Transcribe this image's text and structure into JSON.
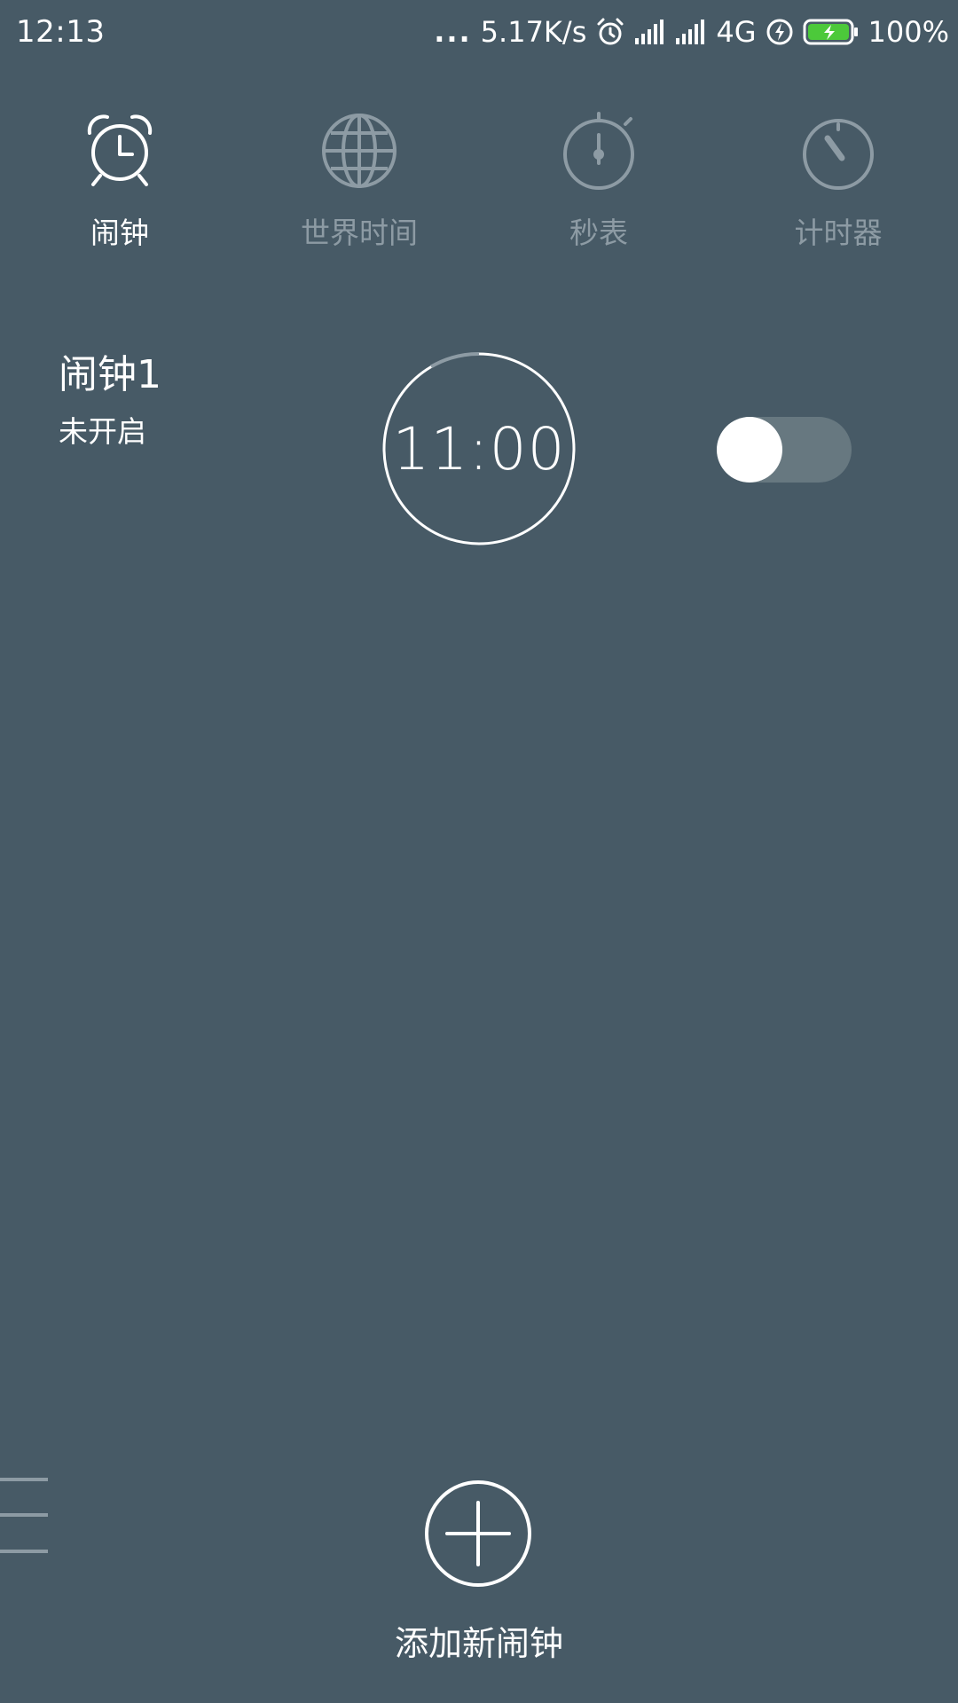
{
  "status_bar": {
    "time": "12:13",
    "dots": "...",
    "network_speed": "5.17K/s",
    "network_type": "4G",
    "battery_percent": "100%",
    "battery_level": 1.0,
    "battery_color": "#4cc93a",
    "icons": [
      "more-dots-icon",
      "alarm-icon",
      "signal-icon",
      "signal-icon",
      "charging-icon",
      "battery-icon"
    ]
  },
  "tabs": [
    {
      "label": "闹钟",
      "icon": "alarm-clock-icon",
      "active": true
    },
    {
      "label": "世界时间",
      "icon": "globe-icon",
      "active": false
    },
    {
      "label": "秒表",
      "icon": "stopwatch-icon",
      "active": false
    },
    {
      "label": "计时器",
      "icon": "timer-icon",
      "active": false
    }
  ],
  "alarm": {
    "name": "闹钟1",
    "status": "未开启",
    "time": "11:00",
    "enabled": false
  },
  "add_alarm": {
    "label": "添加新闹钟",
    "icon": "plus-icon"
  },
  "colors": {
    "background": "#475a66",
    "inactive": "#8d9ba4",
    "active": "#ffffff",
    "toggle_track": "#677880"
  }
}
